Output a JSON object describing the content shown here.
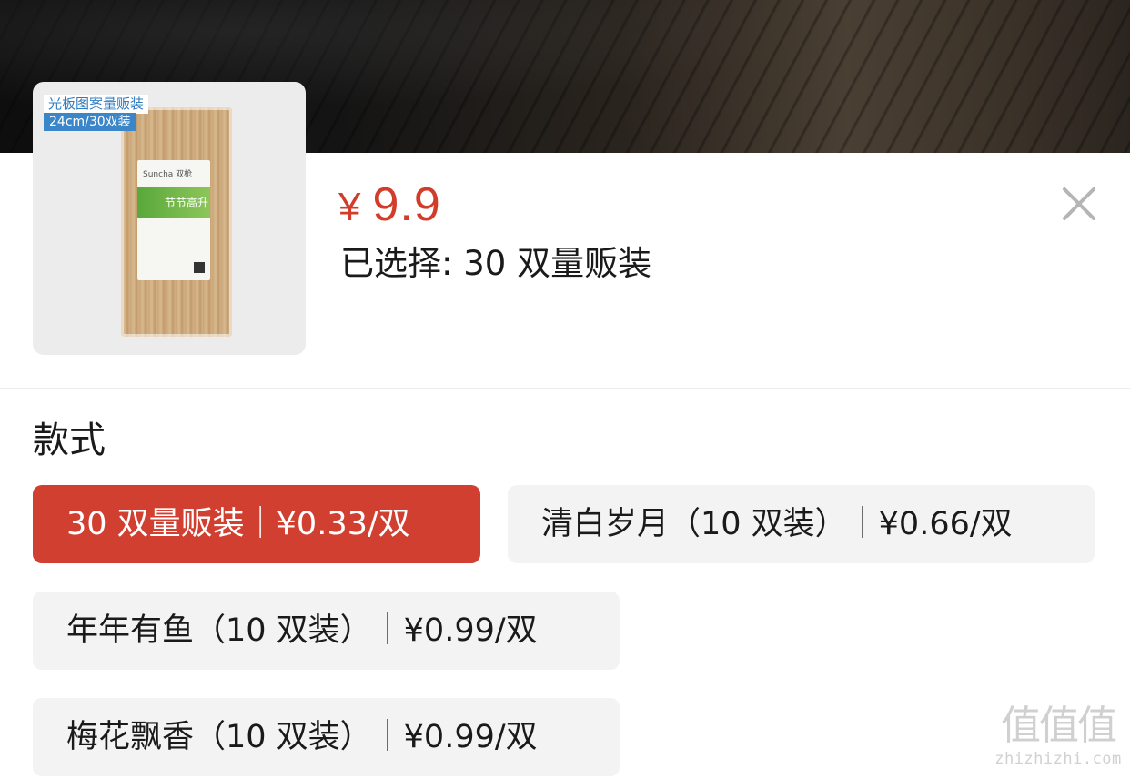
{
  "product": {
    "thumb_tag": "光板图案量贩装",
    "thumb_spec": "24cm/30双装",
    "thumb_brand": "Suncha 双枪",
    "thumb_slogan": "节节高升",
    "price_symbol": "¥",
    "price_value": "9.9",
    "selected_text": "已选择: 30 双量贩装"
  },
  "icons": {
    "close": "close-icon"
  },
  "style_section": {
    "title": "款式",
    "options": [
      {
        "label": "30 双量贩装｜¥0.33/双",
        "selected": true
      },
      {
        "label": "清白岁月（10 双装）｜¥0.66/双",
        "selected": false
      },
      {
        "label": "年年有鱼（10 双装）｜¥0.99/双",
        "selected": false
      },
      {
        "label": "梅花飘香（10 双装）｜¥0.99/双",
        "selected": false
      }
    ]
  },
  "watermark": {
    "big": "值值值",
    "small": "zhizhizhi.com"
  },
  "colors": {
    "accent": "#d13f31",
    "option_bg": "#f3f3f3",
    "text": "#1a1a1a"
  }
}
